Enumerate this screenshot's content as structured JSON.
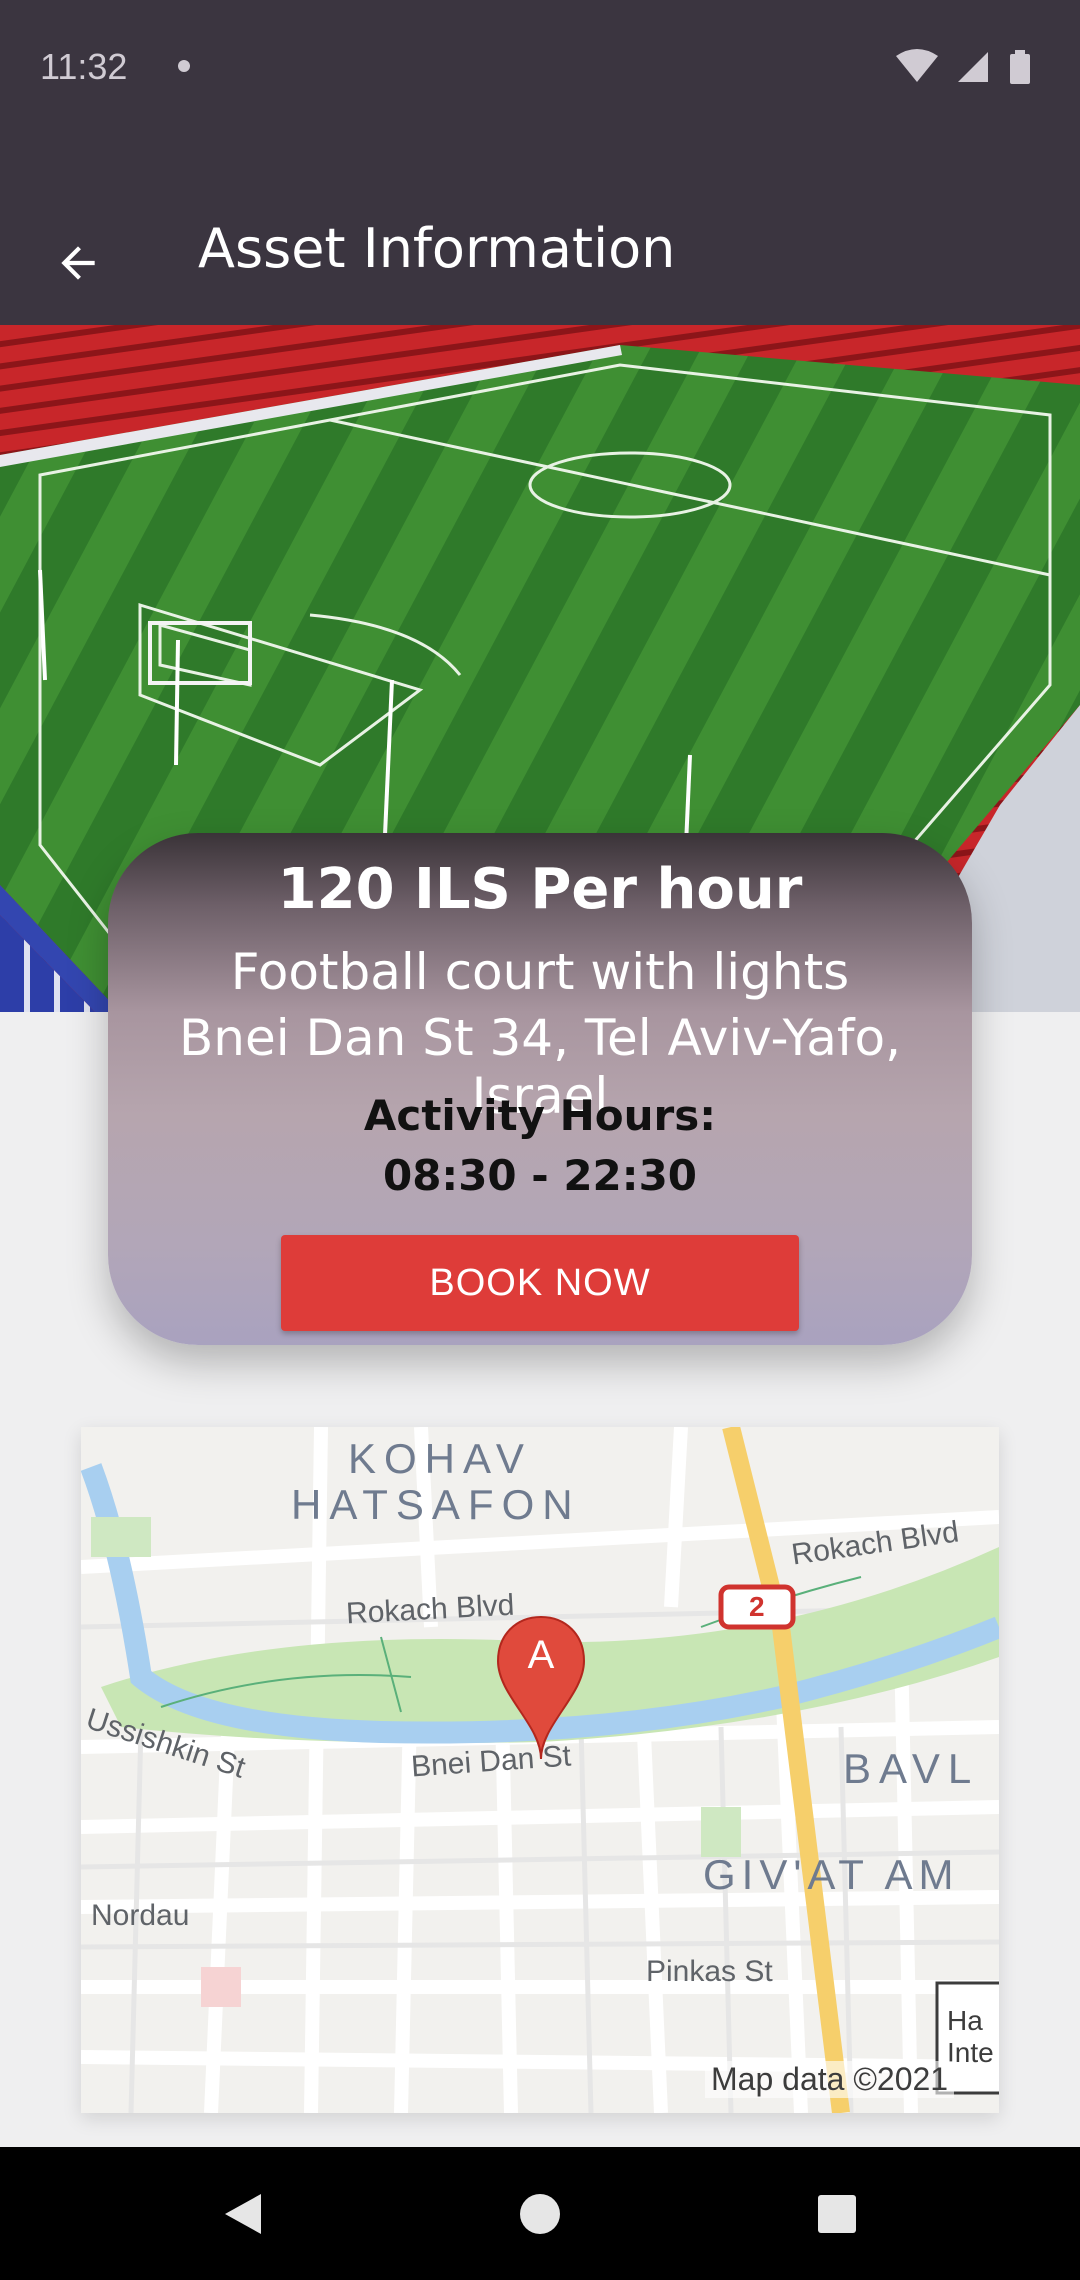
{
  "status_bar": {
    "time": "11:32",
    "icons": [
      "notification-dot-icon",
      "wifi-icon",
      "signal-icon",
      "battery-icon"
    ]
  },
  "app_bar": {
    "back_icon": "arrow-back-icon",
    "title": "Asset Information"
  },
  "hero_image": {
    "subject": "football-stadium-photo"
  },
  "card": {
    "price": "120 ILS Per hour",
    "description": "Football court with lights",
    "address": "Bnei Dan St 34, Tel Aviv-Yafo, Israel",
    "hours_label": "Activity Hours:",
    "hours": "08:30 - 22:30",
    "book_button": "BOOK NOW"
  },
  "map": {
    "marker_label": "A",
    "labels": {
      "kohav": "KOHAV",
      "hatsafon": "HATSAFON",
      "rokach_upper": "Rokach Blvd",
      "rokach_lower": "Rokach Blvd",
      "ussishkin": "Ussishkin St",
      "bnei_dan": "Bnei Dan St",
      "bavl": "BAVL",
      "givat": "GIV'AT AM",
      "nordau": "Nordau",
      "pinkas": "Pinkas St",
      "route": "2",
      "ha_inte": "Ha Inte",
      "attribution": "Map data ©2021"
    },
    "colors": {
      "park": "#c8e6b4",
      "river": "#a8cff0",
      "highway": "#f6cf6b"
    }
  },
  "nav_bar": {
    "icons": [
      "back-triangle-icon",
      "home-circle-icon",
      "recents-square-icon"
    ]
  }
}
